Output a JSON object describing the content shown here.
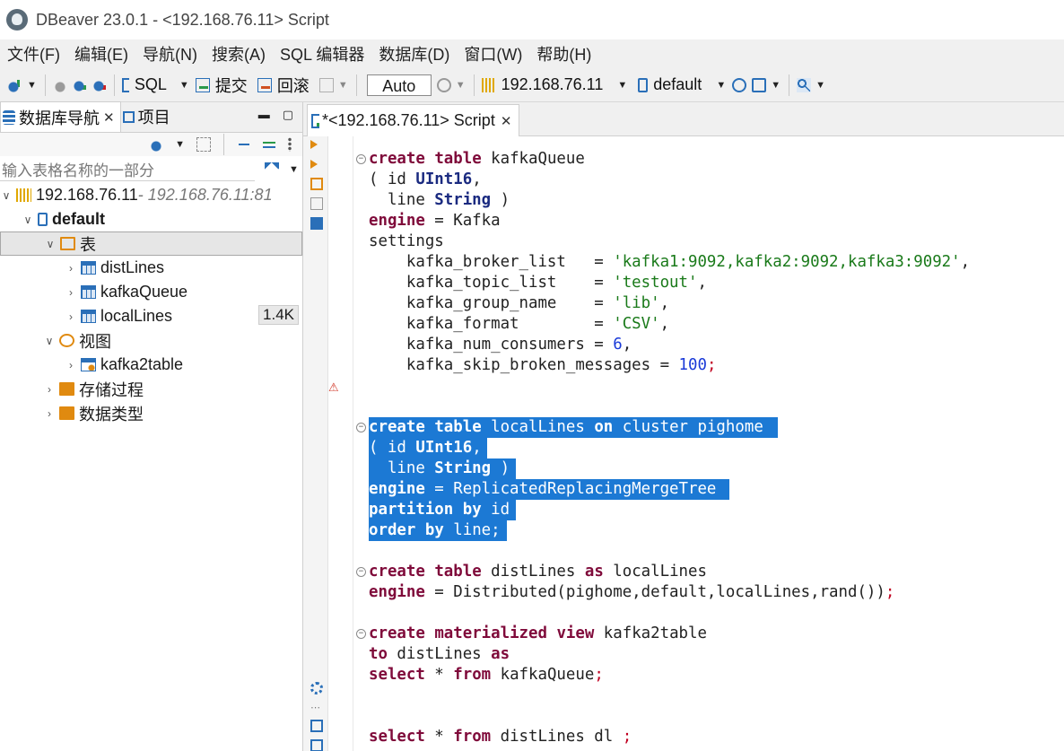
{
  "window": {
    "title": "DBeaver 23.0.1 - <192.168.76.11> Script"
  },
  "menu": [
    "文件(F)",
    "编辑(E)",
    "导航(N)",
    "搜索(A)",
    "SQL 编辑器",
    "数据库(D)",
    "窗口(W)",
    "帮助(H)"
  ],
  "toolbar": {
    "sql_label": "SQL",
    "commit_label": "提交",
    "rollback_label": "回滚",
    "transaction_mode": "Auto",
    "connection": "192.168.76.11",
    "schema": "default"
  },
  "left_panel": {
    "tabs": [
      "数据库导航",
      "项目"
    ],
    "filter_placeholder": "输入表格名称的一部分",
    "tree": [
      {
        "label": "192.168.76.11",
        "suffix": " - 192.168.76.11:81",
        "level": 0,
        "expanded": true
      },
      {
        "label": "default",
        "level": 1,
        "expanded": true
      },
      {
        "label": "表",
        "level": 2,
        "expanded": true,
        "selected": true
      },
      {
        "label": "distLines",
        "level": 3
      },
      {
        "label": "kafkaQueue",
        "level": 3
      },
      {
        "label": "localLines",
        "level": 3,
        "badge": "1.4K"
      },
      {
        "label": "视图",
        "level": 2,
        "expanded": true
      },
      {
        "label": "kafka2table",
        "level": 3
      },
      {
        "label": "存储过程",
        "level": 2
      },
      {
        "label": "数据类型",
        "level": 2
      }
    ]
  },
  "editor": {
    "tab_label": "*<192.168.76.11> Script",
    "lines": [
      "create table kafkaQueue",
      "( id UInt16,",
      "  line String )",
      "engine = Kafka",
      "settings",
      "    kafka_broker_list   = 'kafka1:9092,kafka2:9092,kafka3:9092',",
      "    kafka_topic_list    = 'testout',",
      "    kafka_group_name    = 'lib',",
      "    kafka_format        = 'CSV',",
      "    kafka_num_consumers = 6,",
      "    kafka_skip_broken_messages = 100;",
      "",
      "",
      "create table localLines on cluster pighome",
      "( id UInt16,",
      "  line String )",
      "engine = ReplicatedReplacingMergeTree",
      "partition by id",
      "order by line;",
      "",
      "create table distLines as localLines",
      "engine = Distributed(pighome,default,localLines,rand());",
      "",
      "create materialized view kafka2table",
      "to distLines as",
      "select * from kafkaQueue;",
      "",
      "",
      "select * from distLines dl ;"
    ],
    "selected_lines": [
      13,
      18
    ]
  },
  "colors": {
    "selection": "#1c79d4",
    "keyword": "#7f0a3a",
    "string": "#1a7a1a",
    "number": "#1a3ad8"
  }
}
